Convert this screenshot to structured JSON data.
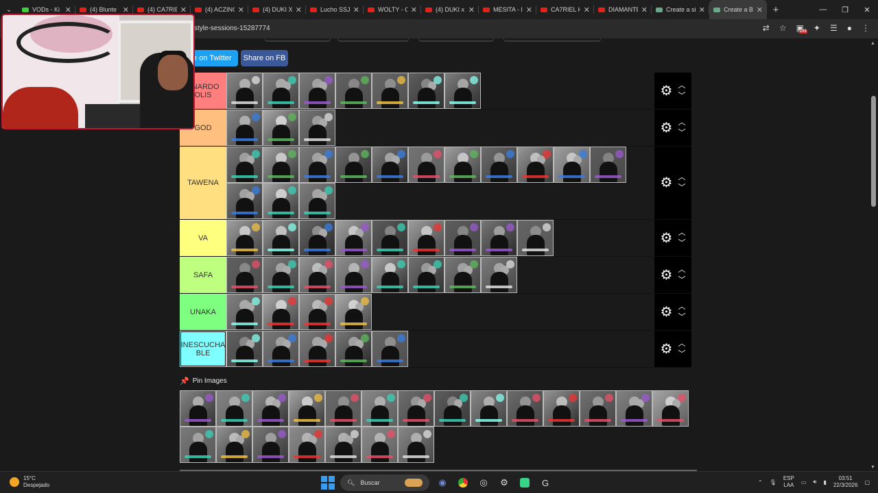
{
  "browser": {
    "tabs": [
      {
        "label": "VODs - Ki",
        "favicon": "twitch-favicon"
      },
      {
        "label": "(4) Blunte",
        "favicon": "youtube-favicon"
      },
      {
        "label": "(4) CA7RIEL",
        "favicon": "youtube-favicon"
      },
      {
        "label": "(4) ACZINO",
        "favicon": "youtube-favicon"
      },
      {
        "label": "(4) DUKI X",
        "favicon": "youtube-favicon"
      },
      {
        "label": "Lucho SSJ",
        "favicon": "youtube-favicon"
      },
      {
        "label": "WOLTY - C",
        "favicon": "youtube-favicon"
      },
      {
        "label": "(4) DUKI x",
        "favicon": "youtube-favicon"
      },
      {
        "label": "MESITA - I",
        "favicon": "youtube-favicon"
      },
      {
        "label": "CA7RIEL H",
        "favicon": "youtube-favicon"
      },
      {
        "label": "DIAMANTE",
        "favicon": "youtube-favicon"
      },
      {
        "label": "Create a si",
        "favicon": "tiermaker-favicon"
      },
      {
        "label": "Create a B",
        "favicon": "tiermaker-favicon",
        "active": true
      }
    ],
    "url_visible": "style-sessions-15287774",
    "extension_badge": "249"
  },
  "share": {
    "twitter": "are on Twitter",
    "fb": "Share on FB"
  },
  "tiers": [
    {
      "label": "ENARDO\nOLIS",
      "color": "#ff7f7f",
      "items": 7,
      "height": 54
    },
    {
      "label": "GOD",
      "color": "#ffbf7f",
      "items": 3,
      "height": 54
    },
    {
      "label": "TAWENA",
      "color": "#ffdf7f",
      "items": 14,
      "height": 107
    },
    {
      "label": "VA",
      "color": "#ffff7f",
      "items": 9,
      "height": 54
    },
    {
      "label": "SAFA",
      "color": "#bfff7f",
      "items": 8,
      "height": 54
    },
    {
      "label": "UNAKA",
      "color": "#7fff7f",
      "items": 4,
      "height": 54
    },
    {
      "label": "INESCUCHA\nBLE",
      "color": "#7fffff",
      "items": 5,
      "height": 54
    }
  ],
  "pin": {
    "label": "Pin Images",
    "items": 21
  },
  "accent_colors": [
    "#3ad1b5",
    "#e0e0e0",
    "#9b59d0",
    "#e94f6a",
    "#5cb85c",
    "#f0c040",
    "#3a7de0",
    "#e33",
    "#8fe"
  ],
  "taskbar": {
    "temp": "15°C",
    "weather": "Despejado",
    "search": "Buscar",
    "lang_top": "ESP",
    "lang_bottom": "LAA",
    "time": "03:51",
    "date": "22/3/2026"
  }
}
